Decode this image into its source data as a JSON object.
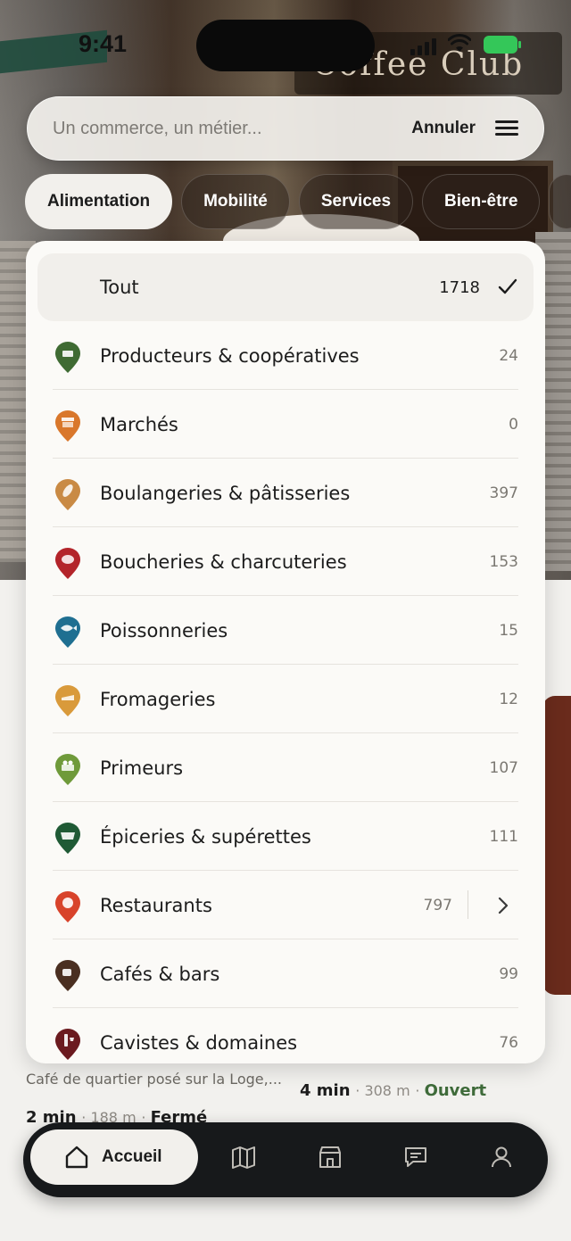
{
  "status_bar": {
    "time": "9:41"
  },
  "search": {
    "placeholder": "Un commerce, un métier...",
    "cancel_label": "Annuler"
  },
  "tabs": [
    "Alimentation",
    "Mobilité",
    "Services",
    "Bien-être"
  ],
  "active_tab": "Alimentation",
  "dropdown": {
    "all": {
      "label": "Tout",
      "count": "1718",
      "selected": true
    },
    "categories": [
      {
        "label": "Producteurs & coopératives",
        "count": "24",
        "icon": "producer-pin-icon",
        "color": "#3f6b33"
      },
      {
        "label": "Marchés",
        "count": "0",
        "icon": "market-pin-icon",
        "color": "#d9772b"
      },
      {
        "label": "Boulangeries & pâtisseries",
        "count": "397",
        "icon": "bread-pin-icon",
        "color": "#c98a44"
      },
      {
        "label": "Boucheries & charcuteries",
        "count": "153",
        "icon": "meat-pin-icon",
        "color": "#b3242a"
      },
      {
        "label": "Poissonneries",
        "count": "15",
        "icon": "fish-pin-icon",
        "color": "#1f6f91"
      },
      {
        "label": "Fromageries",
        "count": "12",
        "icon": "cheese-pin-icon",
        "color": "#d99a3b"
      },
      {
        "label": "Primeurs",
        "count": "107",
        "icon": "produce-pin-icon",
        "color": "#6f9a3a"
      },
      {
        "label": "Épiceries & supérettes",
        "count": "111",
        "icon": "basket-pin-icon",
        "color": "#1f5a35"
      },
      {
        "label": "Restaurants",
        "count": "797",
        "icon": "restaurant-pin-icon",
        "color": "#d8432b",
        "has_submenu": true
      },
      {
        "label": "Cafés & bars",
        "count": "99",
        "icon": "coffee-pin-icon",
        "color": "#4a2f21"
      },
      {
        "label": "Cavistes & domaines",
        "count": "76",
        "icon": "wine-pin-icon",
        "color": "#6b1a1f"
      }
    ]
  },
  "background_listing": {
    "description": "Café de quartier posé sur la Loge,...",
    "card_a": {
      "time": "4 min",
      "distance": "308 m",
      "status": "Ouvert"
    },
    "card_b": {
      "time": "2 min",
      "distance": "188 m",
      "status": "Fermé"
    }
  },
  "hero_sign": "Coffee Club",
  "bottom_nav": {
    "home_label": "Accueil",
    "icons": [
      "map-icon",
      "store-icon",
      "chat-icon",
      "profile-icon"
    ]
  },
  "colors": {
    "accent_green": "#3f6b3a",
    "nav_bg": "#17191b",
    "panel_bg": "#fbfaf7"
  }
}
